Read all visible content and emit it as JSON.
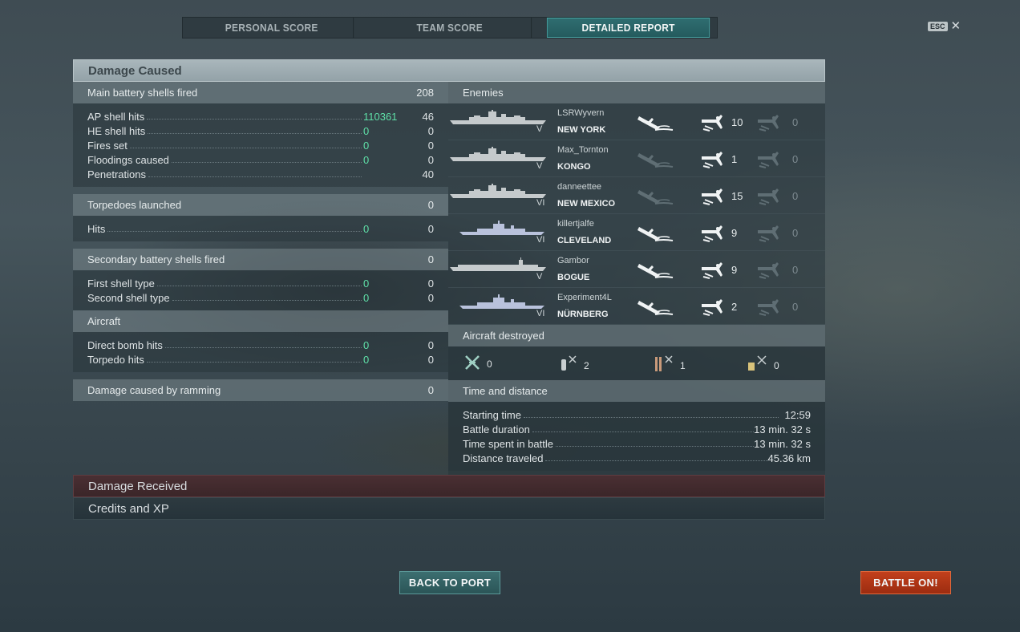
{
  "tabs": [
    "PERSONAL SCORE",
    "TEAM SCORE",
    "DETAILED REPORT"
  ],
  "esc": {
    "key": "ESC",
    "close": "✕"
  },
  "panel_title": "Damage Caused",
  "main_battery": {
    "label": "Main battery shells fired",
    "value": "208",
    "rows": [
      {
        "label": "AP shell hits",
        "green": "110361",
        "value": "46"
      },
      {
        "label": "HE shell hits",
        "green": "0",
        "value": "0"
      },
      {
        "label": "Fires set",
        "green": "0",
        "value": "0"
      },
      {
        "label": "Floodings caused",
        "green": "0",
        "value": "0"
      },
      {
        "label": "Penetrations",
        "green": "",
        "value": "40"
      }
    ]
  },
  "torpedoes": {
    "label": "Torpedoes launched",
    "value": "0",
    "rows": [
      {
        "label": "Hits",
        "green": "0",
        "value": "0"
      }
    ]
  },
  "secondary": {
    "label": "Secondary battery shells fired",
    "value": "0",
    "rows": [
      {
        "label": "First shell type",
        "green": "0",
        "value": "0"
      },
      {
        "label": "Second shell type",
        "green": "0",
        "value": "0"
      }
    ]
  },
  "aircraft": {
    "label": "Aircraft",
    "rows": [
      {
        "label": "Direct bomb hits",
        "green": "0",
        "value": "0"
      },
      {
        "label": "Torpedo hits",
        "green": "0",
        "value": "0"
      }
    ]
  },
  "ramming": {
    "label": "Damage caused by ramming",
    "value": "0"
  },
  "enemies": {
    "label": "Enemies",
    "list": [
      {
        "player": "LSRWyvern",
        "ship": "NEW YORK",
        "tier": "V",
        "hits": "10",
        "other": "0",
        "sunk": true,
        "type": "battleship"
      },
      {
        "player": "Max_Tornton",
        "ship": "KONGO",
        "tier": "V",
        "hits": "1",
        "other": "0",
        "sunk": false,
        "type": "battleship"
      },
      {
        "player": "danneettee",
        "ship": "NEW MEXICO",
        "tier": "VI",
        "hits": "15",
        "other": "0",
        "sunk": false,
        "type": "battleship"
      },
      {
        "player": "killertjalfe",
        "ship": "CLEVELAND",
        "tier": "VI",
        "hits": "9",
        "other": "0",
        "sunk": true,
        "type": "cruiser"
      },
      {
        "player": "Gambor",
        "ship": "BOGUE",
        "tier": "V",
        "hits": "9",
        "other": "0",
        "sunk": true,
        "type": "carrier"
      },
      {
        "player": "Experiment4L",
        "ship": "NÜRNBERG",
        "tier": "VI",
        "hits": "2",
        "other": "0",
        "sunk": true,
        "type": "cruiser"
      }
    ]
  },
  "aircraft_destroyed": {
    "label": "Aircraft destroyed",
    "items": [
      {
        "icon": "fighter-icon",
        "value": "0"
      },
      {
        "icon": "bomber-icon",
        "value": "2"
      },
      {
        "icon": "torpedo-bomber-icon",
        "value": "1"
      },
      {
        "icon": "dive-bomber-icon",
        "value": "0"
      }
    ]
  },
  "time_distance": {
    "label": "Time and distance",
    "rows": [
      {
        "label": "Starting time",
        "value": "12:59"
      },
      {
        "label": "Battle duration",
        "value": "13 min. 32 s"
      },
      {
        "label": "Time spent in battle",
        "value": "13 min. 32 s"
      },
      {
        "label": "Distance traveled",
        "value": "45.36 km"
      }
    ]
  },
  "damage_received": "Damage Received",
  "credits_xp": "Credits and XP",
  "back_to_port": "BACK TO PORT",
  "battle_on": "BATTLE ON!",
  "colors": {
    "accent_green": "#5fe0a8",
    "teal_active": "#2f6e71",
    "battle_orange": "#c2401c"
  }
}
